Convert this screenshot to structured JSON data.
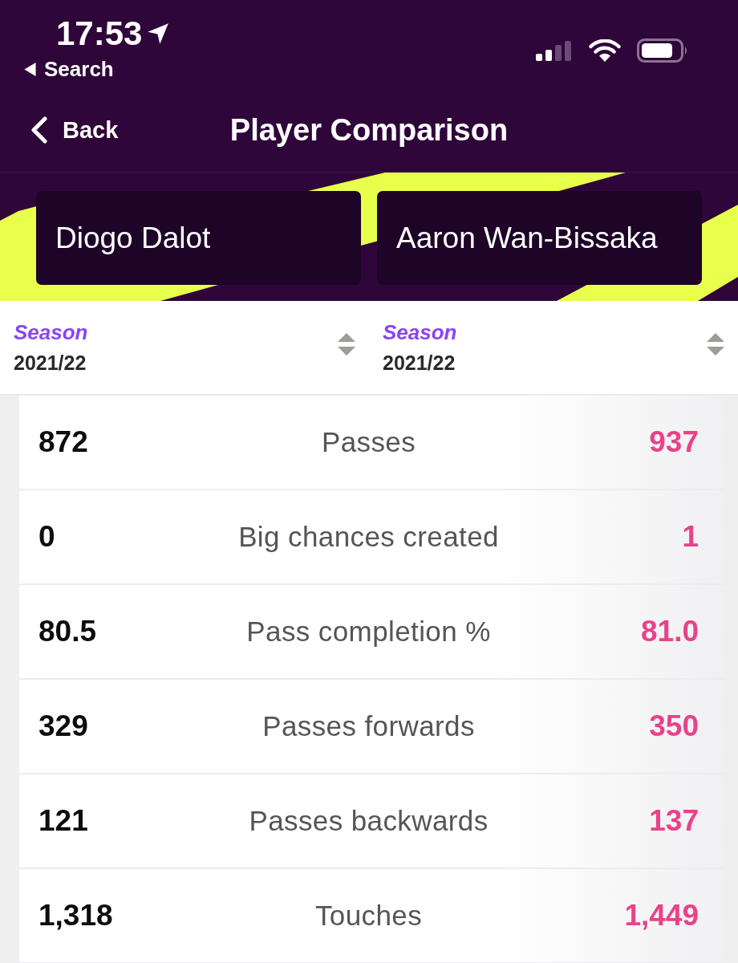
{
  "status_bar": {
    "time": "17:53",
    "back_app": "Search"
  },
  "nav": {
    "back_label": "Back",
    "title": "Player Comparison"
  },
  "players": [
    {
      "name": "Diogo Dalot",
      "season_label": "Season",
      "season": "2021/22"
    },
    {
      "name": "Aaron Wan-Bissaka",
      "season_label": "Season",
      "season": "2021/22"
    }
  ],
  "stats": [
    {
      "label": "Passes",
      "player_1": "872",
      "player_2": "937"
    },
    {
      "label": "Big chances created",
      "player_1": "0",
      "player_2": "1"
    },
    {
      "label": "Pass completion %",
      "player_1": "80.5",
      "player_2": "81.0"
    },
    {
      "label": "Passes forwards",
      "player_1": "329",
      "player_2": "350"
    },
    {
      "label": "Passes backwards",
      "player_1": "121",
      "player_2": "137"
    },
    {
      "label": "Touches",
      "player_1": "1,318",
      "player_2": "1,449"
    }
  ]
}
